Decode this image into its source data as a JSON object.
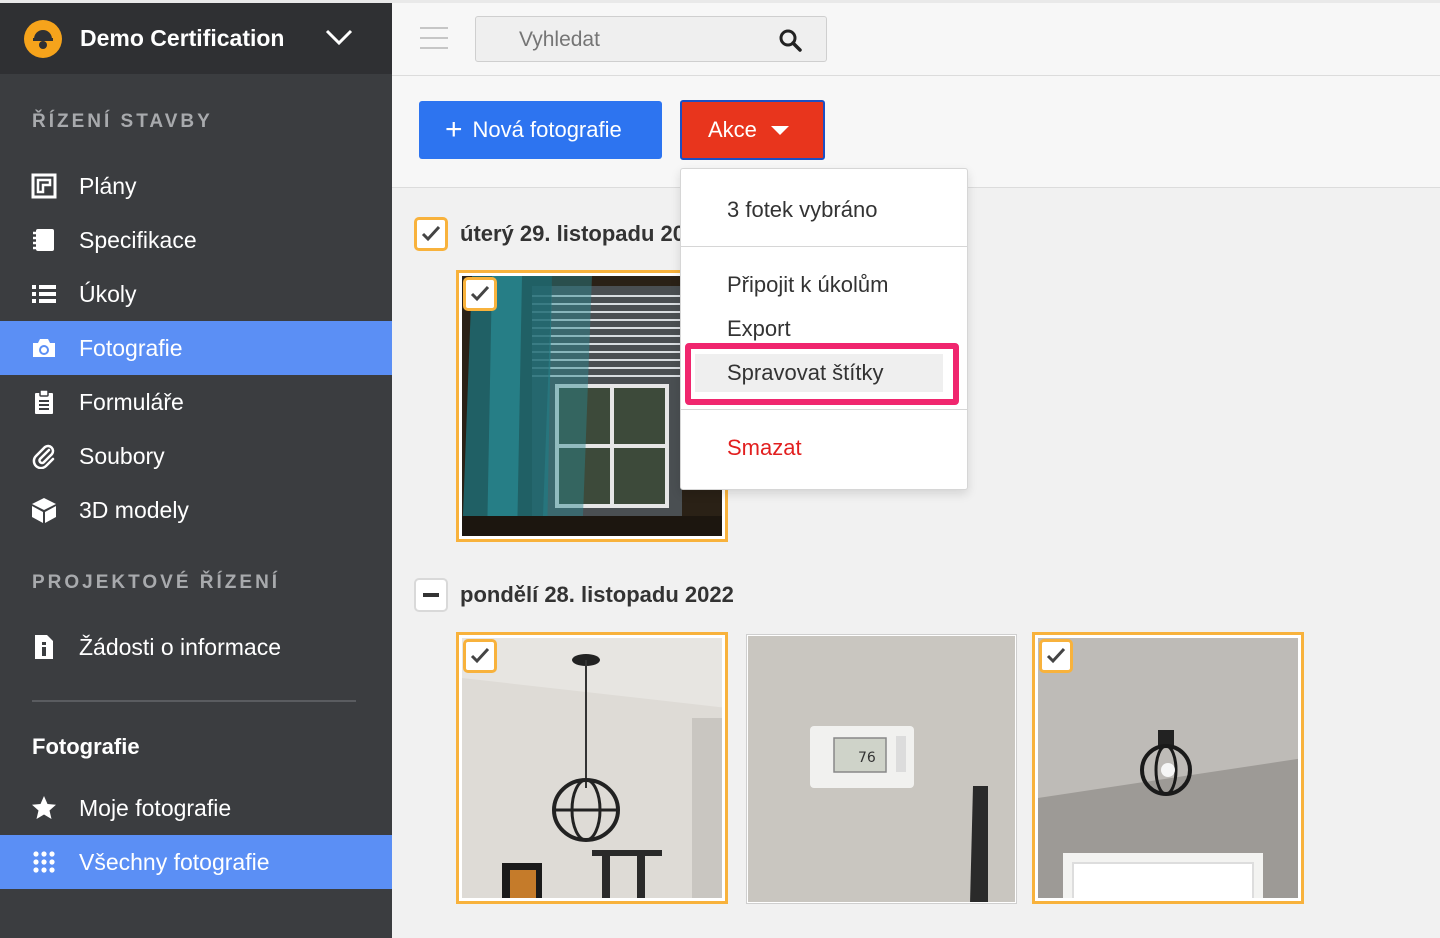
{
  "project": {
    "name": "Demo Certification"
  },
  "sidebar": {
    "section1": "ŘÍZENÍ STAVBY",
    "section1_items": [
      {
        "label": "Plány",
        "icon": "blueprint-icon"
      },
      {
        "label": "Specifikace",
        "icon": "notebook-icon"
      },
      {
        "label": "Úkoly",
        "icon": "list-icon"
      },
      {
        "label": "Fotografie",
        "icon": "camera-icon",
        "active": true
      },
      {
        "label": "Formuláře",
        "icon": "clipboard-icon"
      },
      {
        "label": "Soubory",
        "icon": "paperclip-icon"
      },
      {
        "label": "3D modely",
        "icon": "cube-icon"
      }
    ],
    "section2": "PROJEKTOVÉ ŘÍZENÍ",
    "section2_items": [
      {
        "label": "Žádosti o informace",
        "icon": "info-file-icon"
      }
    ],
    "sub_title": "Fotografie",
    "sub_items": [
      {
        "label": "Moje fotografie",
        "icon": "star-icon"
      },
      {
        "label": "Všechny fotografie",
        "icon": "grid-icon",
        "active": true
      }
    ]
  },
  "search": {
    "placeholder": "Vyhledat"
  },
  "toolbar": {
    "new_photo_label": "Nová fotografie",
    "actions_label": "Akce"
  },
  "groups": [
    {
      "date": "úterý 29. listopadu 20",
      "state": "checked"
    },
    {
      "date": "pondělí 28. listopadu 2022",
      "state": "partial"
    }
  ],
  "actions_menu": {
    "selected_count": "3 fotek vybráno",
    "attach_to_tasks": "Připojit k úkolům",
    "export": "Export",
    "manage_tags": "Spravovat štítky",
    "delete": "Smazat"
  },
  "colors": {
    "primary": "#2d74f0",
    "danger": "#e8351d",
    "selected": "#f8b23c",
    "highlight": "#f0266e",
    "sidebar_active": "#5b8ff5"
  }
}
